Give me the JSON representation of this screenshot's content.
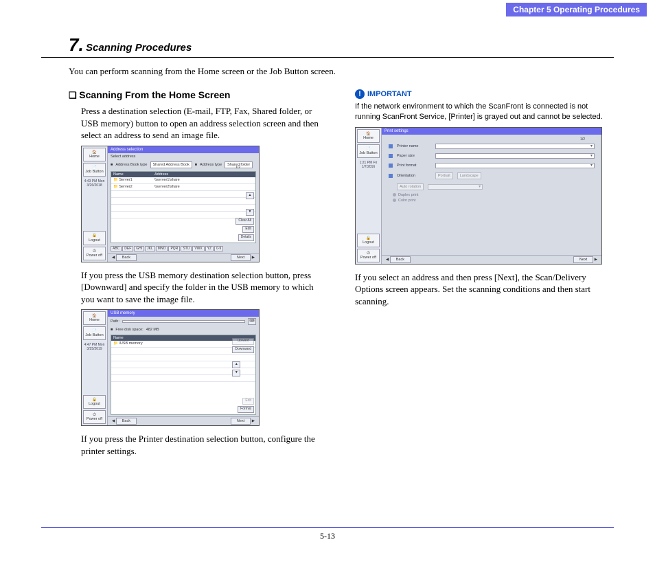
{
  "header": {
    "chapter": "Chapter 5   Operating Procedures"
  },
  "section": {
    "number": "7.",
    "title": "Scanning Procedures"
  },
  "intro": "You can perform scanning from the Home screen or the Job Button screen.",
  "left": {
    "subheading": "Scanning From the Home Screen",
    "p1": "Press a destination selection (E-mail, FTP, Fax, Shared folder, or USB memory) button to open an address selection screen and then select an address to send an image file.",
    "p2": "If you press the USB memory destination selection button, press [Downward] and specify the folder in the USB memory to which you want to save the image file.",
    "p3": "If you press the Printer destination selection button, configure the printer settings."
  },
  "right": {
    "important_label": "IMPORTANT",
    "important_text": "If the network environment to which the ScanFront is connected is not running ScanFront Service, [Printer] is grayed out and cannot be selected.",
    "p1": "If you select an address and then press [Next], the Scan/Delivery Options screen appears. Set the scanning conditions and then start scanning."
  },
  "mock1": {
    "title": "Address selection",
    "toolbar": {
      "l1": "Select address",
      "ab_type_label": "Address Book type",
      "ab_type_value": "Shared Address Book",
      "addr_type_label": "Address type",
      "addr_type_value": "Shared folder"
    },
    "thead": {
      "name": "Name",
      "address": "Address"
    },
    "rows": [
      {
        "name": "Server1",
        "address": "\\\\server1\\share"
      },
      {
        "name": "Server2",
        "address": "\\\\server2\\share"
      }
    ],
    "count": "1/2",
    "side": {
      "clear_all": "Clear All",
      "edit": "Edit",
      "details": "Details"
    },
    "alpha": [
      "ABC",
      "DEF",
      "GHI",
      "JKL",
      "MNO",
      "PQR",
      "STU",
      "VWX",
      "YZ",
      "0-9"
    ],
    "foot": {
      "back": "Back",
      "next": "Next"
    },
    "sidebar": {
      "home": "Home",
      "job": "Job Button",
      "time": "4:43 PM  Mon 3/26/2018",
      "logout": "Logout",
      "power": "Power off"
    }
  },
  "mock2": {
    "title": "USB memory",
    "path_label": "Path:",
    "free_label": "Free disk space:",
    "free_value": "482 MB",
    "thead_name": "Name",
    "row0": "\\USB memory",
    "side": {
      "upward": "Upward",
      "downward": "Downward"
    },
    "bottom": {
      "edit": "Edit",
      "format": "Format"
    },
    "foot": {
      "back": "Back",
      "next": "Next"
    },
    "sidebar": {
      "home": "Home",
      "job": "Job Button",
      "time": "4:47 PM  Mon 3/25/2019",
      "logout": "Logout",
      "power": "Power off"
    }
  },
  "mock3": {
    "title": "Print settings",
    "rows": {
      "printer": "Printer name",
      "paper": "Paper size",
      "format": "Print format",
      "orientation": "Orientation",
      "portrait": "Portrait",
      "landscape": "Landscape",
      "auto": "Auto rotation",
      "dup_print": "Duplex print",
      "color": "Color print"
    },
    "count": "1/2",
    "foot": {
      "back": "Back",
      "next": "Next"
    },
    "sidebar": {
      "home": "Home",
      "job": "Job Button",
      "time": "1:21 PM  Fri 1/7/2016",
      "logout": "Logout",
      "power": "Power off"
    }
  },
  "page_number": "5-13"
}
